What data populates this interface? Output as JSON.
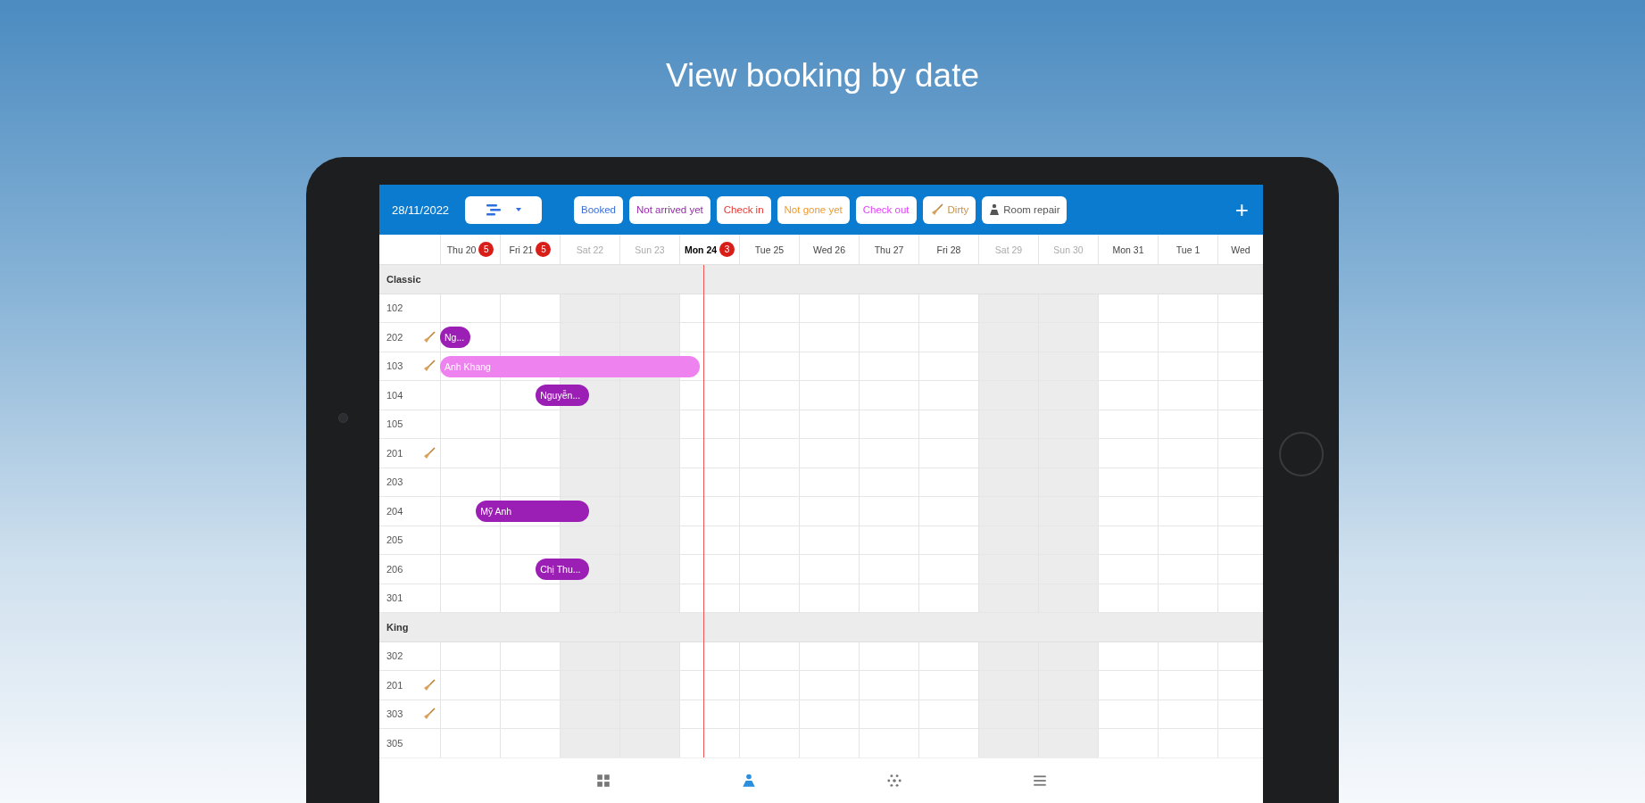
{
  "title": "View booking by date",
  "header": {
    "date": "28/11/2022",
    "add_symbol": "+"
  },
  "legend": [
    {
      "label": "Booked",
      "kind": "text",
      "color": "#3b6fd8"
    },
    {
      "label": "Not arrived yet",
      "kind": "text",
      "color": "#9b27af"
    },
    {
      "label": "Check in",
      "kind": "text",
      "color": "#e53935"
    },
    {
      "label": "Not gone yet",
      "kind": "text",
      "color": "#f09a2a"
    },
    {
      "label": "Check out",
      "kind": "text",
      "color": "#e040fb"
    },
    {
      "label": "Dirty",
      "kind": "broom",
      "color": "#c8924a"
    },
    {
      "label": "Room repair",
      "kind": "worker",
      "color": "#555555"
    }
  ],
  "days": [
    {
      "label": "Thu 20",
      "weekend": false,
      "today": false,
      "badge": "5"
    },
    {
      "label": "Fri 21",
      "weekend": false,
      "today": false,
      "badge": "5"
    },
    {
      "label": "Sat 22",
      "weekend": true,
      "today": false
    },
    {
      "label": "Sun 23",
      "weekend": true,
      "today": false
    },
    {
      "label": "Mon 24",
      "weekend": false,
      "today": true,
      "badge": "3"
    },
    {
      "label": "Tue 25",
      "weekend": false,
      "today": false
    },
    {
      "label": "Wed 26",
      "weekend": false,
      "today": false
    },
    {
      "label": "Thu 27",
      "weekend": false,
      "today": false
    },
    {
      "label": "Fri 28",
      "weekend": false,
      "today": false
    },
    {
      "label": "Sat 29",
      "weekend": true,
      "today": false
    },
    {
      "label": "Sun 30",
      "weekend": true,
      "today": false
    },
    {
      "label": "Mon 31",
      "weekend": false,
      "today": false
    },
    {
      "label": "Tue 1",
      "weekend": false,
      "today": false
    },
    {
      "label": "Wed",
      "weekend": false,
      "today": false
    }
  ],
  "groups": [
    {
      "name": "Classic",
      "rooms": [
        {
          "number": "102",
          "dirty": false
        },
        {
          "number": "202",
          "dirty": true,
          "bookings": [
            {
              "guest": "Ng...",
              "color": "#9c1fb5"
            }
          ]
        },
        {
          "number": "103",
          "dirty": true,
          "bookings": [
            {
              "guest": "Anh Khang",
              "color": "#ee82ee"
            }
          ]
        },
        {
          "number": "104",
          "dirty": false,
          "bookings": [
            {
              "guest": "Nguyễn...",
              "color": "#9c1fb5"
            }
          ]
        },
        {
          "number": "105",
          "dirty": false
        },
        {
          "number": "201",
          "dirty": true
        },
        {
          "number": "203",
          "dirty": false
        },
        {
          "number": "204",
          "dirty": false,
          "bookings": [
            {
              "guest": "Mỹ Anh",
              "color": "#9c1fb5"
            }
          ]
        },
        {
          "number": "205",
          "dirty": false
        },
        {
          "number": "206",
          "dirty": false,
          "bookings": [
            {
              "guest": "Chị Thu...",
              "color": "#9c1fb5"
            }
          ]
        },
        {
          "number": "301",
          "dirty": false
        }
      ]
    },
    {
      "name": "King",
      "rooms": [
        {
          "number": "302",
          "dirty": false
        },
        {
          "number": "201",
          "dirty": true
        },
        {
          "number": "303",
          "dirty": true
        },
        {
          "number": "305",
          "dirty": false
        }
      ]
    }
  ],
  "bottom_nav": [
    {
      "kind": "grid",
      "selected": false
    },
    {
      "kind": "person",
      "selected": true
    },
    {
      "kind": "network",
      "selected": false
    },
    {
      "kind": "menu",
      "selected": false
    }
  ]
}
